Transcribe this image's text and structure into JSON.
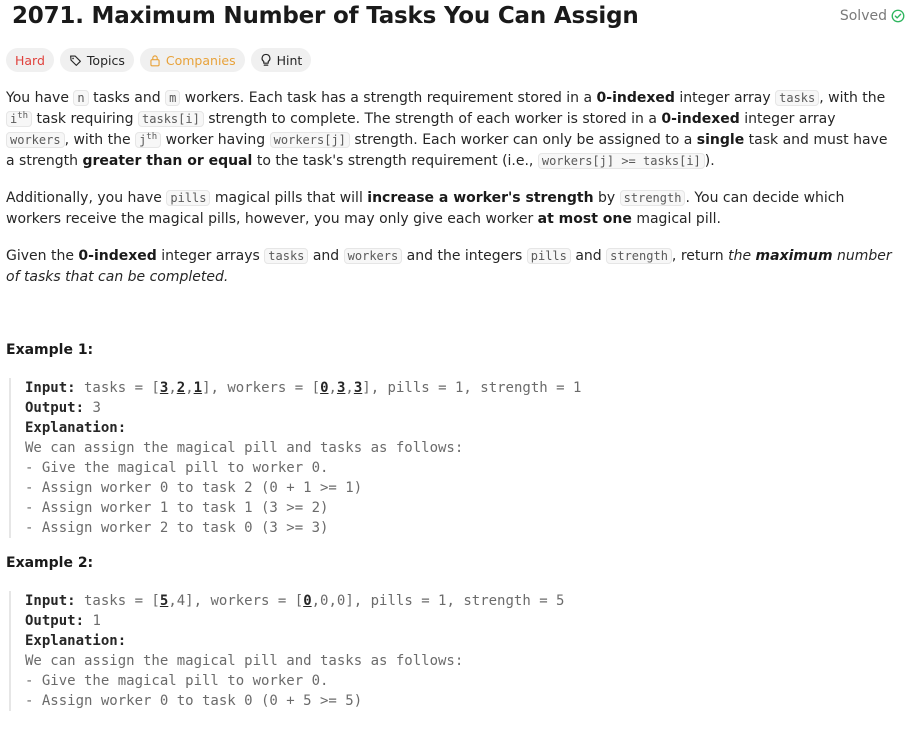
{
  "problem": {
    "title": "2071. Maximum Number of Tasks You Can Assign",
    "status": "Solved"
  },
  "chips": {
    "difficulty": "Hard",
    "topics": "Topics",
    "companies": "Companies",
    "hint": "Hint"
  },
  "colors": {
    "hard": "#e0423d",
    "companies": "#e8a23a",
    "solved_check": "#2db55d"
  },
  "icons": {
    "solved": "check-circle-icon",
    "topics": "tag-icon",
    "companies": "lock-icon",
    "hint": "lightbulb-icon"
  },
  "description": {
    "p1": {
      "t1": "You have ",
      "c_n": "n",
      "t2": " tasks and ",
      "c_m": "m",
      "t3": " workers. Each task has a strength requirement stored in a ",
      "b_indexed1": "0-indexed",
      "t4": " integer array ",
      "c_tasks": "tasks",
      "t5": ", with the ",
      "c_i": "i",
      "sup_th1": "th",
      "t6": " task requiring ",
      "c_tasks_i": "tasks[i]",
      "t7": " strength to complete. The strength of each worker is stored in a ",
      "b_indexed2": "0-indexed",
      "t8": " integer array ",
      "c_workers": "workers",
      "t9": ", with the ",
      "c_j": "j",
      "sup_th2": "th",
      "t10": " worker having ",
      "c_workers_j": "workers[j]",
      "t11": " strength. Each worker can only be assigned to a ",
      "b_single": "single",
      "t12": " task and must have a strength ",
      "b_geq": "greater than or equal",
      "t13": " to the task's strength requirement (i.e., ",
      "c_cond": "workers[j] >= tasks[i]",
      "t14": ")."
    },
    "p2": {
      "t1": "Additionally, you have ",
      "c_pills": "pills",
      "t2": " magical pills that will ",
      "b_increase": "increase a worker's strength",
      "t3": " by ",
      "c_strength": "strength",
      "t4": ". You can decide which workers receive the magical pills, however, you may only give each worker ",
      "b_atmost": "at most one",
      "t5": " magical pill."
    },
    "p3": {
      "t1": "Given the ",
      "b_indexed": "0-indexed",
      "t2": " integer arrays ",
      "c_tasks": "tasks",
      "t3": " and ",
      "c_workers": "workers",
      "t4": " and the integers ",
      "c_pills": "pills",
      "t5": " and ",
      "c_strength": "strength",
      "t6": ", return ",
      "i_the": "the ",
      "bi_max": "maximum",
      "i_rest": " number of tasks that can be completed."
    }
  },
  "examples": [
    {
      "title": "Example 1:",
      "input_label": "Input:",
      "input_pre": " tasks = [",
      "input_tasks": [
        "3",
        "2",
        "1"
      ],
      "input_mid": "], workers = [",
      "input_workers": [
        "0",
        "3",
        "3"
      ],
      "input_post": "], pills = 1, strength = 1",
      "output_label": "Output:",
      "output_value": " 3",
      "explanation_label": "Explanation:",
      "lines": [
        "We can assign the magical pill and tasks as follows:",
        "- Give the magical pill to worker 0.",
        "- Assign worker 0 to task 2 (0 + 1 >= 1)",
        "- Assign worker 1 to task 1 (3 >= 2)",
        "- Assign worker 2 to task 0 (3 >= 3)"
      ]
    },
    {
      "title": "Example 2:",
      "input_label": "Input:",
      "input_pre": " tasks = [",
      "input_tasks_first": "5",
      "input_tasks_rest": ",4",
      "input_mid": "], workers = [",
      "input_workers_first": "0",
      "input_workers_rest": ",0,0",
      "input_post": "], pills = 1, strength = 5",
      "output_label": "Output:",
      "output_value": " 1",
      "explanation_label": "Explanation:",
      "lines": [
        "We can assign the magical pill and tasks as follows:",
        "- Give the magical pill to worker 0.",
        "- Assign worker 0 to task 0 (0 + 5 >= 5)"
      ]
    }
  ]
}
